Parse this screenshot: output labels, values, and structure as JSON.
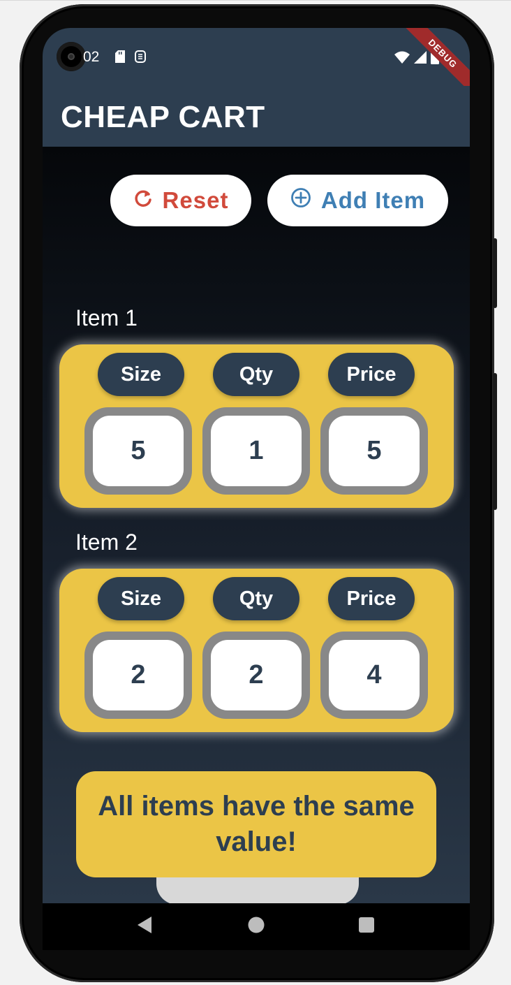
{
  "status_bar": {
    "time": "02",
    "debug_label": "DEBUG"
  },
  "app_bar": {
    "title": "CHEAP CART"
  },
  "actions": {
    "reset_label": "Reset",
    "add_item_label": "Add Item"
  },
  "items": [
    {
      "label": "Item 1",
      "headers": [
        "Size",
        "Qty",
        "Price"
      ],
      "values": [
        "5",
        "1",
        "5"
      ]
    },
    {
      "label": "Item 2",
      "headers": [
        "Size",
        "Qty",
        "Price"
      ],
      "values": [
        "2",
        "2",
        "4"
      ]
    }
  ],
  "result": {
    "message": "All items have the same value!"
  },
  "colors": {
    "app_bar": "#2d3e50",
    "card": "#ebc546",
    "reset": "#d14a3b",
    "add_item": "#3f7fb4",
    "debug_banner": "#a02b2b"
  },
  "icons": {
    "reset": "refresh-icon",
    "add_item": "add-circle-icon",
    "nav_back": "triangle-back-icon",
    "nav_home": "circle-home-icon",
    "nav_recents": "square-recents-icon"
  }
}
